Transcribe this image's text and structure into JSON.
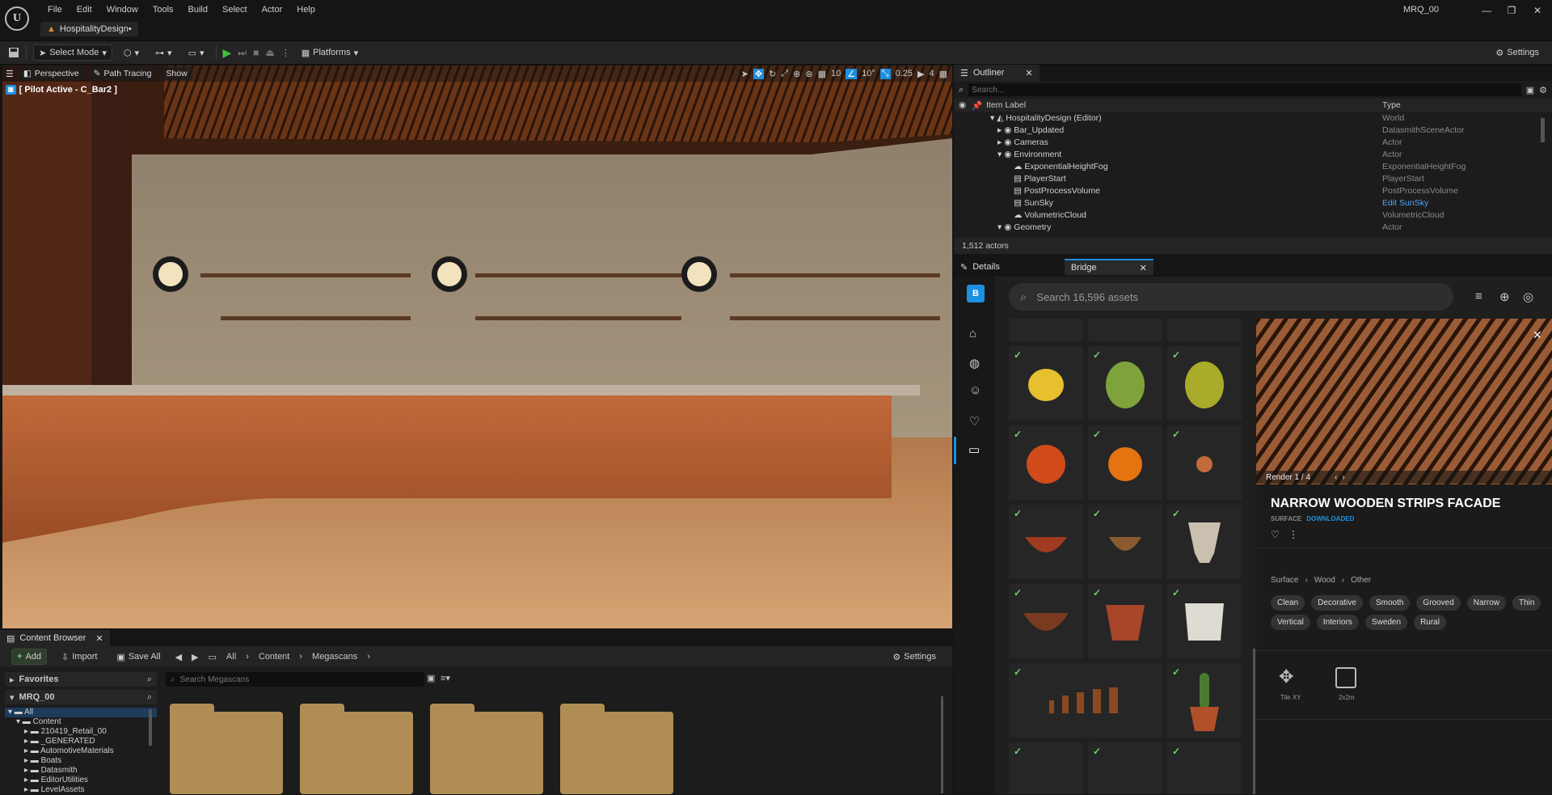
{
  "app": {
    "menu": [
      "File",
      "Edit",
      "Window",
      "Tools",
      "Build",
      "Select",
      "Actor",
      "Help"
    ],
    "project_tab": "HospitalityDesign•",
    "project_name": "MRQ_00"
  },
  "toolbar": {
    "mode": "Select Mode",
    "platforms": "Platforms",
    "settings": "Settings"
  },
  "viewport": {
    "perspective": "Perspective",
    "path_tracing": "Path Tracing",
    "show": "Show",
    "pilot": "[ Pilot Active - C_Bar2 ]",
    "grid_snap": "10",
    "rot_snap": "10°",
    "scale_snap": "0.25",
    "cam_speed": "4"
  },
  "outliner": {
    "title": "Outliner",
    "search_placeholder": "Search...",
    "col_label": "Item Label",
    "col_type": "Type",
    "rows": [
      {
        "label": "HospitalityDesign (Editor)",
        "type": "World"
      },
      {
        "label": "Bar_Updated",
        "type": "DatasmithSceneActor"
      },
      {
        "label": "Cameras",
        "type": "Actor"
      },
      {
        "label": "Environment",
        "type": "Actor"
      },
      {
        "label": "ExponentialHeightFog",
        "type": "ExponentialHeightFog"
      },
      {
        "label": "PlayerStart",
        "type": "PlayerStart"
      },
      {
        "label": "PostProcessVolume",
        "type": "PostProcessVolume"
      },
      {
        "label": "SunSky",
        "type": "Edit SunSky"
      },
      {
        "label": "VolumetricCloud",
        "type": "VolumetricCloud"
      },
      {
        "label": "Geometry",
        "type": "Actor"
      }
    ],
    "count": "1,512 actors"
  },
  "panels": {
    "details_tab": "Details",
    "bridge_tab": "Bridge"
  },
  "bridge": {
    "search_placeholder": "Search 16,596 assets",
    "render_label": "Render 1 / 4",
    "asset_title": "NARROW WOODEN STRIPS FACADE",
    "asset_type": "SURFACE",
    "asset_status": "DOWNLOADED",
    "breadcrumb": [
      "Surface",
      "Wood",
      "Other"
    ],
    "tags": [
      "Clean",
      "Decorative",
      "Smooth",
      "Grooved",
      "Narrow",
      "Thin",
      "Vertical",
      "Interiors",
      "Sweden",
      "Rural"
    ],
    "tile_label": "Tile XY",
    "size_label": "2x2m"
  },
  "content_browser": {
    "tab": "Content Browser",
    "add": "Add",
    "import": "Import",
    "save_all": "Save All",
    "path": [
      "All",
      "Content",
      "Megascans"
    ],
    "settings": "Settings",
    "favorites": "Favorites",
    "project": "MRQ_00",
    "search_placeholder": "Search Megascans",
    "tree": [
      "All",
      "Content",
      "210419_Retail_00",
      "_GENERATED",
      "AutomotiveMaterials",
      "Boats",
      "Datasmith",
      "EditorUtilities",
      "LevelAssets"
    ]
  },
  "colors": {
    "accent_blue": "#1d8fe0",
    "check_green": "#6fd36f",
    "folder": "#b08d55"
  }
}
